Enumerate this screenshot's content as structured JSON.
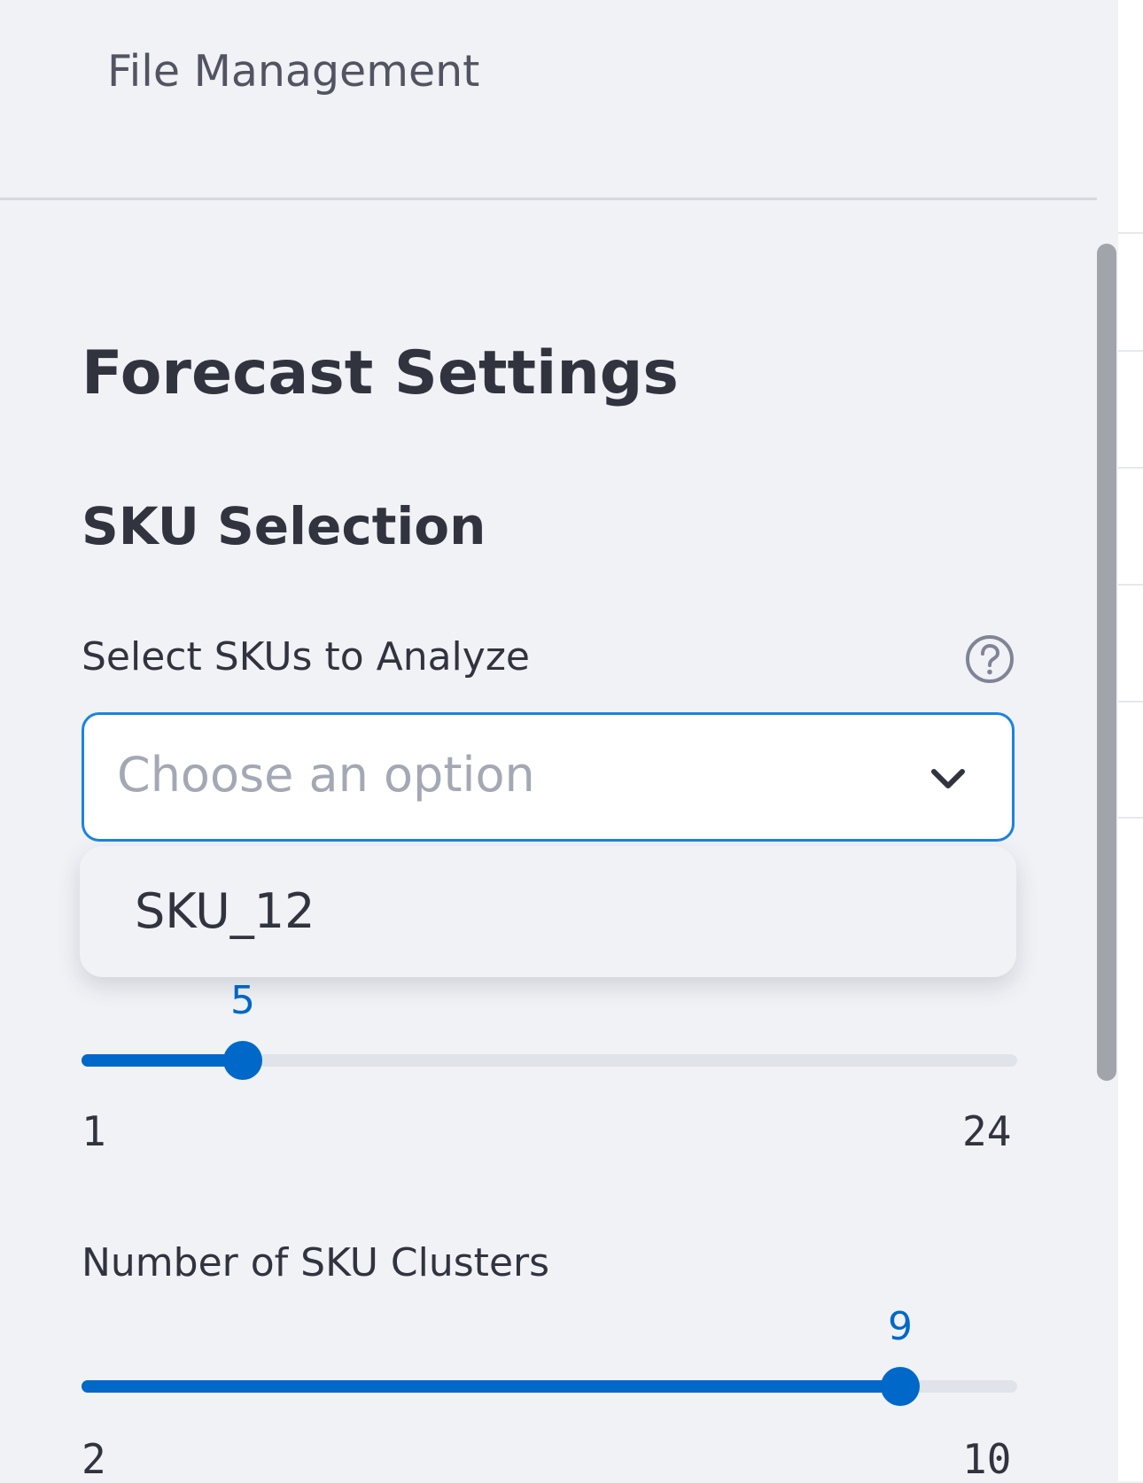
{
  "nav": {
    "file_management": "File Management"
  },
  "headings": {
    "forecast_settings": "Forecast Settings",
    "sku_selection": "SKU Selection"
  },
  "sku_select": {
    "label": "Select SKUs to Analyze",
    "placeholder": "Choose an option",
    "help_icon": "question-circle-icon",
    "chevron_icon": "chevron-down-icon",
    "options": [
      "SKU_12"
    ]
  },
  "slider_one": {
    "value": "5",
    "min": "1",
    "max": "24"
  },
  "slider_clusters": {
    "label": "Number of SKU Clusters",
    "value": "9",
    "min": "2",
    "max": "10"
  },
  "colors": {
    "accent": "#0068c9",
    "focus_border": "#1c83e1",
    "background": "#f0f2f6",
    "text": "#31333f"
  }
}
